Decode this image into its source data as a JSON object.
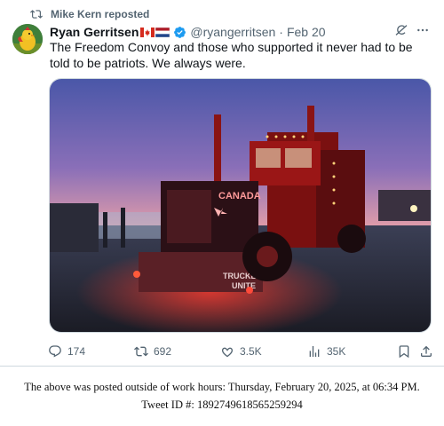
{
  "repost": {
    "label": "Mike Kern reposted"
  },
  "post": {
    "author_name": "Ryan Gerritsen",
    "handle": "@ryangerritsen",
    "separator": "·",
    "date": "Feb 20",
    "text": "The Freedom Convoy and those who supported it never had to be told to be patriots. We always were.",
    "image_text": {
      "trailer_word": "CANADA",
      "grille_word_1": "TRUCKERS",
      "grille_word_2": "UNITE"
    }
  },
  "actions": {
    "replies": "174",
    "reposts": "692",
    "likes": "3.5K",
    "views": "35K"
  },
  "icons": {
    "repost": "repost-icon",
    "verified": "verified-badge-icon",
    "grok": "grok-icon",
    "more": "more-icon",
    "reply": "reply-icon",
    "like": "heart-icon",
    "views": "analytics-icon",
    "bookmark": "bookmark-icon",
    "share": "share-icon"
  },
  "colors": {
    "accent": "#1d9bf0",
    "muted": "#536471",
    "text": "#0f1419"
  },
  "footer": {
    "line1": "The above was posted outside of work hours: Thursday, February 20, 2025, at 06:34 PM.",
    "line2": "Tweet ID #: 1892749618565259294"
  }
}
